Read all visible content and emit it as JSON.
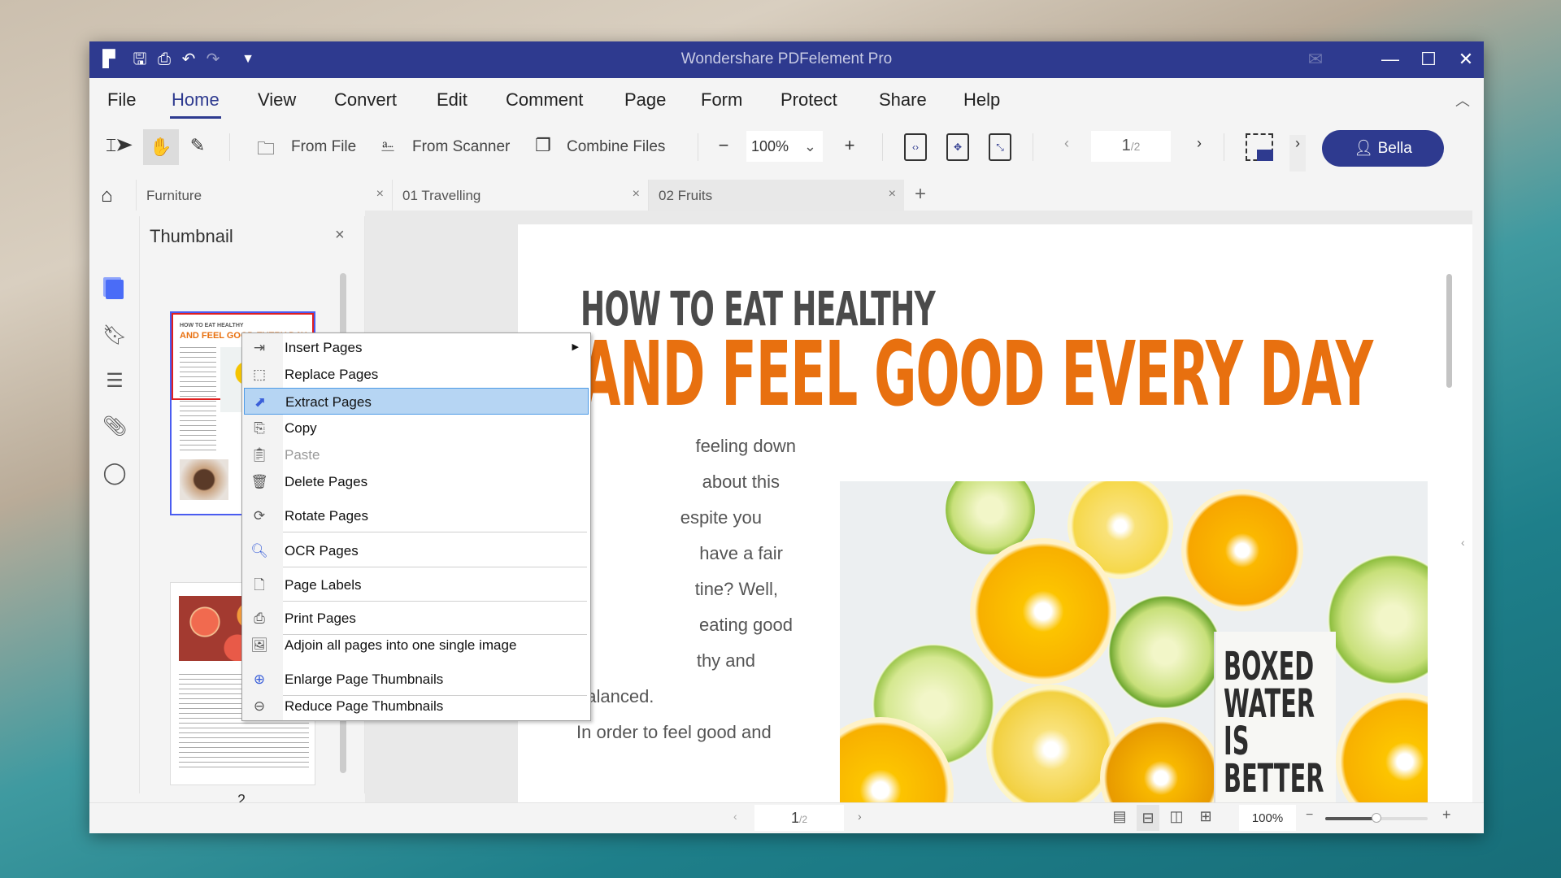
{
  "window": {
    "title": "Wondershare PDFelement Pro"
  },
  "menu": [
    "File",
    "Home",
    "View",
    "Convert",
    "Edit",
    "Comment",
    "Page",
    "Form",
    "Protect",
    "Share",
    "Help"
  ],
  "toolbar": {
    "from_file": "From File",
    "from_scanner": "From Scanner",
    "combine_files": "Combine Files",
    "zoom": "100%",
    "page_current": "1",
    "page_total": "/2",
    "user": "Bella"
  },
  "tabs": [
    {
      "label": "Furniture"
    },
    {
      "label": "01 Travelling"
    },
    {
      "label": "02 Fruits"
    }
  ],
  "thumbnail": {
    "title": "Thumbnail",
    "page2_label": "2",
    "thumb1_line1": "HOW TO EAT HEALTHY",
    "thumb1_line2": "AND FEEL GOOD EVERY DAY"
  },
  "context_menu": [
    {
      "label": "Insert Pages",
      "icon": "insert-pages-icon",
      "submenu": true
    },
    {
      "label": "Replace Pages",
      "icon": "replace-pages-icon"
    },
    {
      "label": "Extract Pages",
      "icon": "extract-pages-icon",
      "highlighted": true
    },
    {
      "label": "Copy",
      "icon": "copy-icon"
    },
    {
      "label": "Paste",
      "icon": "paste-icon",
      "disabled": true
    },
    {
      "label": "Delete Pages",
      "icon": "trash-icon"
    },
    {
      "label": "Rotate Pages",
      "icon": "rotate-icon"
    },
    {
      "label": "OCR Pages",
      "icon": "ocr-icon"
    },
    {
      "label": "Page Labels",
      "icon": "page-label-icon"
    },
    {
      "label": "Print Pages",
      "icon": "print-icon"
    },
    {
      "label": "Adjoin all pages into one single image",
      "icon": "image-icon"
    },
    {
      "label": "Enlarge Page Thumbnails",
      "icon": "zoom-in-icon"
    },
    {
      "label": "Reduce Page Thumbnails",
      "icon": "zoom-out-icon"
    }
  ],
  "document": {
    "heading1": "HOW TO EAT HEALTHY",
    "heading2": "AND FEEL GOOD EVERY DAY",
    "body_lines": [
      "feeling down",
      "about this",
      "espite you",
      "have a fair",
      "tine? Well,",
      "eating good",
      "thy and",
      "balanced.",
      "In order to feel good and"
    ],
    "carton_text": [
      "BOXED",
      "WATER",
      "IS",
      "BETTER"
    ]
  },
  "status": {
    "page_current": "1",
    "page_total": "/2",
    "zoom": "100%",
    "zoom_slider_percent": 50
  },
  "colors": {
    "brand": "#2e3a8f",
    "highlight": "#b6d5f3",
    "accent_orange": "#e8700f"
  }
}
